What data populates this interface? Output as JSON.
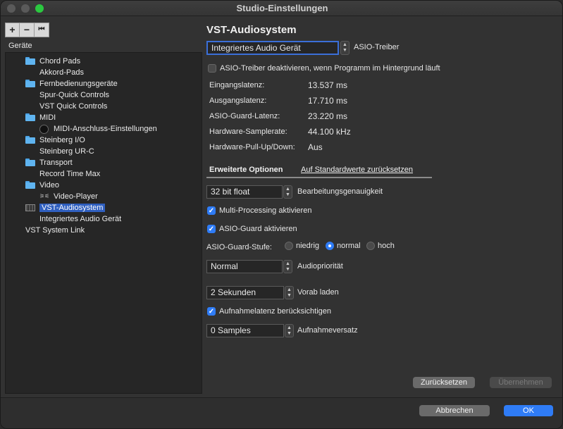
{
  "window": {
    "title": "Studio-Einstellungen"
  },
  "toolbar": {
    "add_symbol": "+",
    "remove_symbol": "−",
    "reset_symbol": "⏮"
  },
  "sidebar": {
    "label": "Geräte",
    "items": [
      {
        "label": "Chord Pads",
        "level": 1,
        "icon": "folder-icon"
      },
      {
        "label": "Akkord-Pads",
        "level": 2,
        "icon": ""
      },
      {
        "label": "Fernbedienungsgeräte",
        "level": 1,
        "icon": "folder-icon"
      },
      {
        "label": "Spur-Quick Controls",
        "level": 2,
        "icon": ""
      },
      {
        "label": "VST Quick Controls",
        "level": 2,
        "icon": ""
      },
      {
        "label": "MIDI",
        "level": 1,
        "icon": "folder-icon"
      },
      {
        "label": "MIDI-Anschluss-Einstellungen",
        "level": 2,
        "icon": "midi-port-icon"
      },
      {
        "label": "Steinberg I/O",
        "level": 1,
        "icon": "folder-icon"
      },
      {
        "label": "Steinberg UR-C",
        "level": 2,
        "icon": ""
      },
      {
        "label": "Transport",
        "level": 1,
        "icon": "folder-icon"
      },
      {
        "label": "Record Time Max",
        "level": 2,
        "icon": ""
      },
      {
        "label": "Video",
        "level": 1,
        "icon": "folder-icon"
      },
      {
        "label": "Video-Player",
        "level": 2,
        "icon": "video-icon"
      },
      {
        "label": "VST-Audiosystem",
        "level": 1,
        "icon": "audio-system-icon",
        "selected": true
      },
      {
        "label": "Integriertes Audio Gerät",
        "level": 2,
        "icon": ""
      },
      {
        "label": "VST System Link",
        "level": 0,
        "icon": ""
      }
    ]
  },
  "main": {
    "heading": "VST-Audiosystem",
    "driver": {
      "value": "Integriertes Audio Gerät",
      "label": "ASIO-Treiber"
    },
    "deactivate_checkbox": {
      "label": "ASIO-Treiber deaktivieren, wenn Programm im Hintergrund läuft",
      "checked": false
    },
    "info": [
      {
        "label": "Eingangslatenz:",
        "value": "13.537 ms"
      },
      {
        "label": "Ausgangslatenz:",
        "value": "17.710 ms"
      },
      {
        "label": "ASIO-Guard-Latenz:",
        "value": "23.220 ms"
      },
      {
        "label": "Hardware-Samplerate:",
        "value": "44.100 kHz"
      },
      {
        "label": "Hardware-Pull-Up/Down:",
        "value": "Aus"
      }
    ],
    "tabs": {
      "advanced": "Erweiterte Optionen",
      "reset_defaults": "Auf Standardwerte zurücksetzen"
    },
    "precision": {
      "value": "32 bit float",
      "label": "Bearbeitungsgenauigkeit"
    },
    "multiprocessing": {
      "label": "Multi-Processing aktivieren",
      "checked": true
    },
    "asio_guard": {
      "label": "ASIO-Guard aktivieren",
      "checked": true
    },
    "asio_guard_level": {
      "label": "ASIO-Guard-Stufe:",
      "options": [
        "niedrig",
        "normal",
        "hoch"
      ],
      "selected": "normal"
    },
    "priority": {
      "value": "Normal",
      "label": "Audiopriorität"
    },
    "preload": {
      "value": "2 Sekunden",
      "label": "Vorab laden"
    },
    "record_latency": {
      "label": "Aufnahmelatenz berücksichtigen",
      "checked": true
    },
    "record_offset": {
      "value": "0 Samples",
      "label": "Aufnahmeversatz"
    },
    "reset_button": "Zurücksetzen",
    "apply_button": "Übernehmen"
  },
  "footer": {
    "cancel_button": "Abbrechen",
    "ok_button": "OK"
  },
  "colors": {
    "accent": "#2f7cf6",
    "selection": "#2f5fbf",
    "folder": "#5fb4f0"
  }
}
